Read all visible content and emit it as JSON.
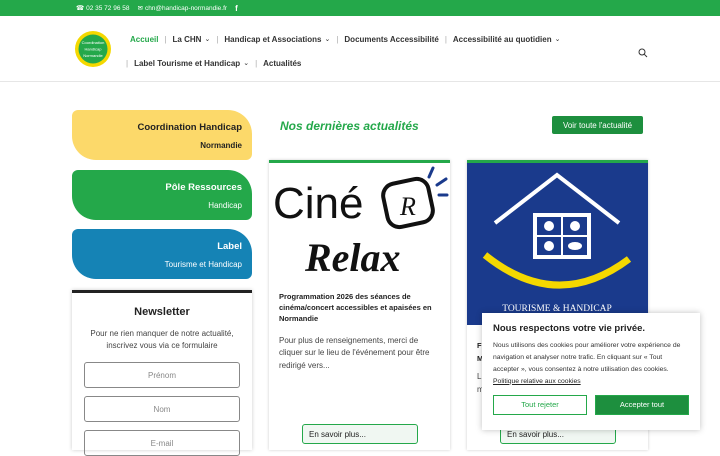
{
  "topbar": {
    "phone": "02 35 72 96 58",
    "email": "chn@handicap-normandie.fr"
  },
  "logo": {
    "lines": [
      "Coordination",
      "Handicap",
      "Normandie"
    ]
  },
  "nav": {
    "row1": [
      {
        "label": "Accueil",
        "active": true,
        "dropdown": false
      },
      {
        "label": "La CHN",
        "dropdown": true
      },
      {
        "label": "Handicap et Associations",
        "dropdown": true
      },
      {
        "label": "Documents Accessibilité",
        "dropdown": false
      },
      {
        "label": "Accessibilité au quotidien",
        "dropdown": true
      }
    ],
    "row2": [
      {
        "label": "Label Tourisme et Handicap",
        "dropdown": true
      },
      {
        "label": "Actualités",
        "dropdown": false
      }
    ]
  },
  "cards": [
    {
      "l1": "Coordination Handicap",
      "l2": "Normandie"
    },
    {
      "l1": "Pôle Ressources",
      "l2": "Handicap"
    },
    {
      "l1": "Label",
      "l2": "Tourisme et Handicap"
    }
  ],
  "newsletter": {
    "title": "Newsletter",
    "text": "Pour ne rien manquer de notre actualité, inscrivez vous via ce formulaire",
    "fields": [
      "Prénom",
      "Nom",
      "E-mail"
    ]
  },
  "news": {
    "heading": "Nos dernières actualités",
    "all_button": "Voir toute l'actualité",
    "posts": [
      {
        "img_text_1": "Ciné",
        "img_badge": "R",
        "img_text_2": "Relax",
        "title": "Programmation 2026 des séances de cinéma/concert accessibles et apaisées en Normandie",
        "text": "Pour plus de renseignements, merci de cliquer sur le lieu de l'événement pour être redirigé vers...",
        "read_more": "En savoir plus..."
      },
      {
        "img_caption": "TOURISME & HANDICAP",
        "title_partial": "F",
        "title_partial2": "M",
        "text_partial": "L",
        "text_partial2": "m",
        "read_more": "En savoir plus..."
      }
    ]
  },
  "cookie": {
    "title": "Nous respectons votre vie privée.",
    "text": "Nous utilisons des cookies pour améliorer votre expérience de navigation et analyser notre trafic. En cliquant sur « Tout accepter », vous consentez à notre utilisation des cookies.",
    "policy_link": "Politique relative aux cookies",
    "reject": "Tout rejeter",
    "accept": "Accepter tout"
  },
  "colors": {
    "green": "#24a84a",
    "yellow": "#fcd96a",
    "blue": "#1583b5",
    "navy": "#1a3a8c"
  }
}
